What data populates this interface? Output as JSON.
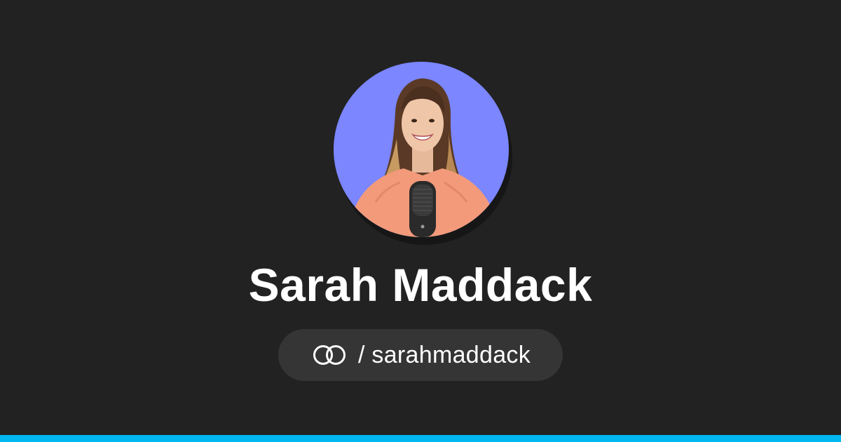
{
  "profile": {
    "name": "Sarah Maddack",
    "separator": "/",
    "handle": "sarahmaddack",
    "avatar_background": "#7b86ff"
  },
  "brand": {
    "logo_icon": "linked-rings-icon",
    "accent": "#00b6f0"
  },
  "colors": {
    "page_background": "#222222",
    "pill_background": "#353535",
    "text": "#ffffff"
  }
}
